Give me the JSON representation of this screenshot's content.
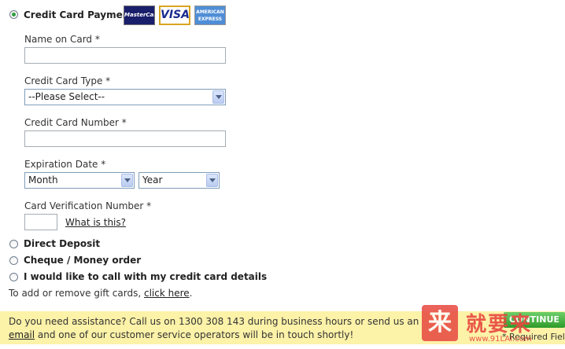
{
  "payment_options": {
    "credit_card": {
      "label": "Credit Card Payment",
      "selected": true
    },
    "direct_deposit": {
      "label": "Direct Deposit",
      "selected": false
    },
    "cheque": {
      "label": "Cheque / Money order",
      "selected": false
    },
    "call": {
      "label": "I would like to call with my credit card details",
      "selected": false
    }
  },
  "card_logos": {
    "mastercard": "MasterCard",
    "visa": "VISA",
    "amex": "AMERICAN EXPRESS"
  },
  "form": {
    "name_on_card": {
      "label": "Name on Card *",
      "value": ""
    },
    "card_type": {
      "label": "Credit Card Type *",
      "selected": "--Please Select--"
    },
    "card_number": {
      "label": "Credit Card Number *",
      "value": ""
    },
    "expiration": {
      "label": "Expiration Date *",
      "month": "Month",
      "year": "Year"
    },
    "cvn": {
      "label": "Card Verification Number *",
      "value": "",
      "help_link": "What is this?"
    }
  },
  "gift_cards": {
    "text_before": "To add or remove gift cards, ",
    "link": "click here",
    "text_after": "."
  },
  "assistance": {
    "text_before": "Do you need assistance? Call us on 1300 308 143 during business hours or send us an ",
    "link": "email",
    "text_after": " and one of our customer service operators will be in touch shortly!"
  },
  "continue_label": "CONTINUE",
  "required_label": "* Required Field",
  "watermark": {
    "stamp": "来",
    "text": "就要来",
    "url": "www.91LAI.com"
  },
  "colors": {
    "banner": "#fcf2a8",
    "continue": "#2e9a2a",
    "radio_selected": "#2f9e3f"
  }
}
